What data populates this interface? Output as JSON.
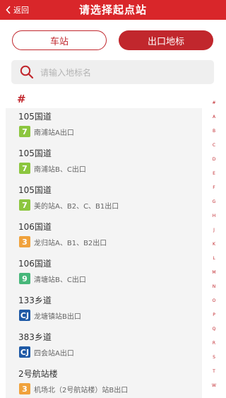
{
  "header": {
    "back_label": "返回",
    "title": "请选择起点站"
  },
  "segment": {
    "station_label": "车站",
    "exit_label": "出口地标"
  },
  "search": {
    "placeholder": "请输入地标名"
  },
  "section": {
    "label": "#"
  },
  "items": [
    {
      "name": "105国道",
      "line": "7",
      "line_color": "#8cc63f",
      "exit": "南浦站A出口"
    },
    {
      "name": "105国道",
      "line": "7",
      "line_color": "#8cc63f",
      "exit": "南浦站B、C出口"
    },
    {
      "name": "105国道",
      "line": "7",
      "line_color": "#8cc63f",
      "exit": "美的站A、B2、C、B1出口"
    },
    {
      "name": "106国道",
      "line": "3",
      "line_color": "#f0a23c",
      "exit": "龙归站A、B1、B2出口"
    },
    {
      "name": "106国道",
      "line": "9",
      "line_color": "#47b77a",
      "exit": "清塘站B、C出口"
    },
    {
      "name": "133乡道",
      "line": "CJ",
      "line_color": "#1f5aa6",
      "exit": "龙塘镇站B出口"
    },
    {
      "name": "383乡道",
      "line": "CJ",
      "line_color": "#1f5aa6",
      "exit": "四会站A出口"
    },
    {
      "name": "2号航站楼",
      "line": "3",
      "line_color": "#f0a23c",
      "exit": "机场北（2号航站楼）站B出口"
    }
  ],
  "index": [
    "#",
    "A",
    "B",
    "C",
    "D",
    "E",
    "F",
    "G",
    "H",
    "J",
    "K",
    "L",
    "M",
    "N",
    "O",
    "P",
    "Q",
    "R",
    "S",
    "T",
    "W"
  ],
  "colors": {
    "header": "#d9262a",
    "accent": "#c1272d"
  }
}
